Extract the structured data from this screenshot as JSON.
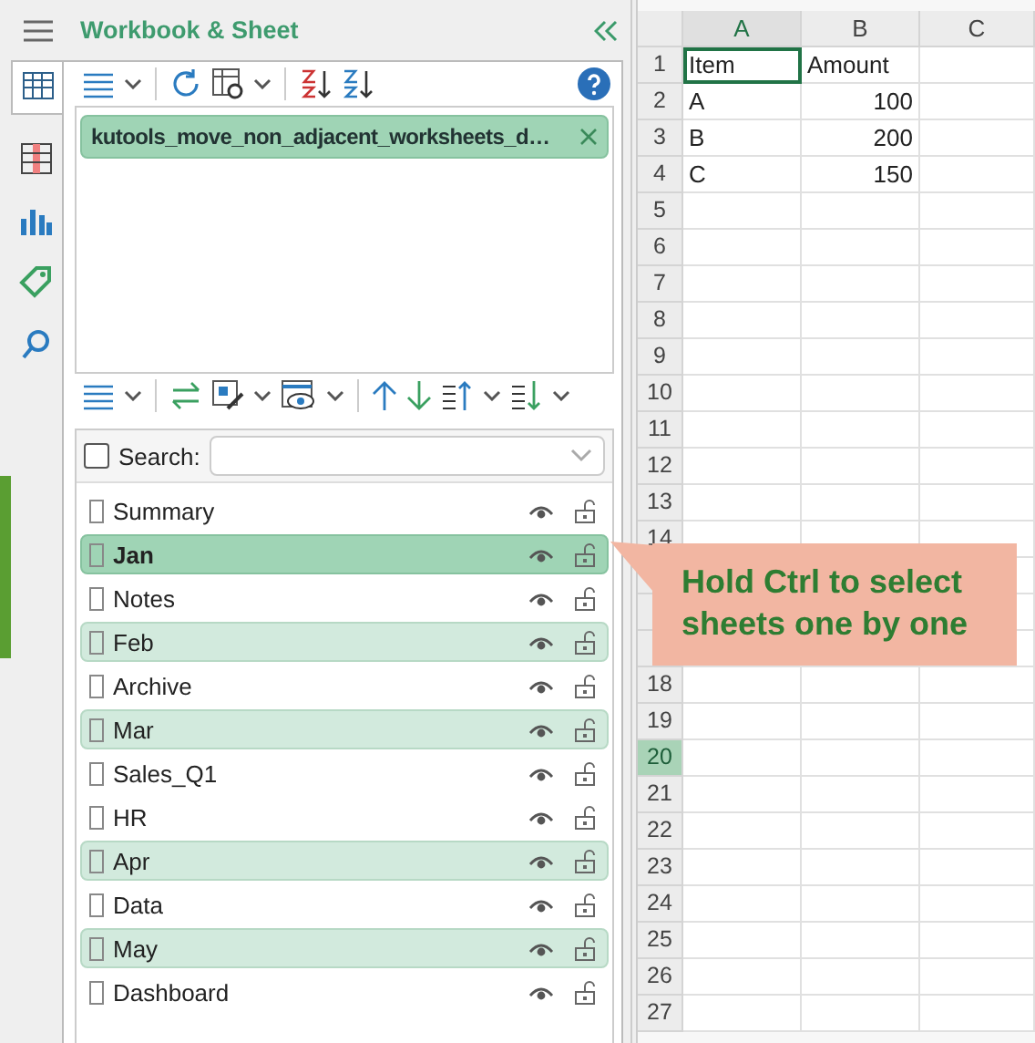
{
  "panel": {
    "title": "Workbook & Sheet"
  },
  "workbooks": [
    {
      "name": "kutools_move_non_adjacent_worksheets_d…",
      "selected": true
    }
  ],
  "search": {
    "label": "Search:",
    "checked": false
  },
  "sheets": [
    {
      "name": "Summary",
      "selected": false,
      "active": false
    },
    {
      "name": "Jan",
      "selected": true,
      "active": true
    },
    {
      "name": "Notes",
      "selected": false,
      "active": false
    },
    {
      "name": "Feb",
      "selected": true,
      "active": false
    },
    {
      "name": "Archive",
      "selected": false,
      "active": false
    },
    {
      "name": "Mar",
      "selected": true,
      "active": false
    },
    {
      "name": "Sales_Q1",
      "selected": false,
      "active": false
    },
    {
      "name": "HR",
      "selected": false,
      "active": false
    },
    {
      "name": "Apr",
      "selected": true,
      "active": false
    },
    {
      "name": "Data",
      "selected": false,
      "active": false
    },
    {
      "name": "May",
      "selected": true,
      "active": false
    },
    {
      "name": "Dashboard",
      "selected": false,
      "active": false
    }
  ],
  "grid": {
    "columns": [
      "A",
      "B",
      "C"
    ],
    "rows": [
      {
        "label": "1",
        "selected": false,
        "cells": [
          {
            "text": "Item",
            "kind": "text",
            "active": true
          },
          {
            "text": "Amount",
            "kind": "text",
            "active": false
          }
        ]
      },
      {
        "label": "2",
        "selected": false,
        "cells": [
          {
            "text": "A",
            "kind": "text",
            "active": false
          },
          {
            "text": "100",
            "kind": "number",
            "active": false
          }
        ]
      },
      {
        "label": "3",
        "selected": false,
        "cells": [
          {
            "text": "B",
            "kind": "text",
            "active": false
          },
          {
            "text": "200",
            "kind": "number",
            "active": false
          }
        ]
      },
      {
        "label": "4",
        "selected": false,
        "cells": [
          {
            "text": "C",
            "kind": "text",
            "active": false
          },
          {
            "text": "150",
            "kind": "number",
            "active": false
          }
        ]
      },
      {
        "label": "5",
        "selected": false
      },
      {
        "label": "6",
        "selected": false
      },
      {
        "label": "7",
        "selected": false
      },
      {
        "label": "8",
        "selected": false
      },
      {
        "label": "9",
        "selected": false
      },
      {
        "label": "10",
        "selected": false
      },
      {
        "label": "11",
        "selected": false
      },
      {
        "label": "12",
        "selected": false
      },
      {
        "label": "13",
        "selected": false
      },
      {
        "label": "14",
        "selected": false
      },
      {
        "selected": false
      },
      {
        "selected": false
      },
      {
        "selected": false
      },
      {
        "label": "18",
        "selected": false
      },
      {
        "label": "19",
        "selected": false
      },
      {
        "label": "20",
        "selected": true
      },
      {
        "label": "21",
        "selected": false
      },
      {
        "label": "22",
        "selected": false
      },
      {
        "label": "23",
        "selected": false
      },
      {
        "label": "24",
        "selected": false
      },
      {
        "label": "25",
        "selected": false
      },
      {
        "label": "26",
        "selected": false
      },
      {
        "label": "27",
        "selected": false
      }
    ]
  },
  "callout": {
    "text": "Hold Ctrl to select sheets one by one"
  }
}
